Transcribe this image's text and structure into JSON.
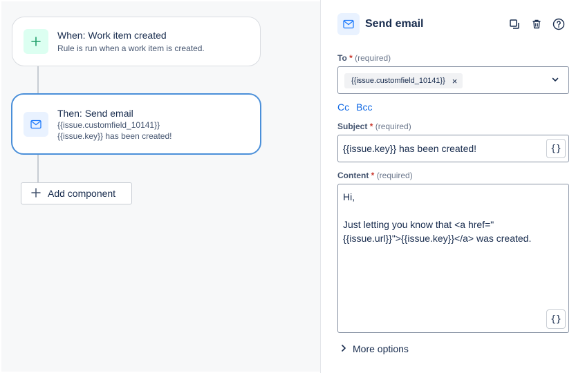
{
  "canvas": {
    "trigger": {
      "title": "When: Work item created",
      "subtitle": "Rule is run when a work item is created.",
      "icon": "plus-icon",
      "accent": "#22a06b"
    },
    "action": {
      "title": "Then: Send email",
      "line1": "{{issue.customfield_10141}}",
      "line2": "{{issue.key}} has been created!",
      "icon": "mail-icon",
      "accent": "#4a8fd9"
    },
    "add_component": {
      "label": "Add component",
      "icon": "plus-icon"
    }
  },
  "panel": {
    "title": "Send email",
    "header_actions": [
      "duplicate-icon",
      "trash-icon",
      "help-icon"
    ],
    "to": {
      "label": "To",
      "star": "*",
      "required_text": "(required)",
      "chip": "{{issue.customfield_10141}}",
      "chip_remove": "×"
    },
    "cc_label": "Cc",
    "bcc_label": "Bcc",
    "subject": {
      "label": "Subject",
      "star": "*",
      "required_text": "(required)",
      "value": "{{issue.key}} has been created!",
      "smart_value_button": "{}"
    },
    "content": {
      "label": "Content",
      "star": "*",
      "required_text": "(required)",
      "value": "Hi,\n\nJust letting you know that <a href=\"\n{{issue.url}}\">{{issue.key}}</a> was created.",
      "smart_value_button": "{}"
    },
    "more_options": "More options"
  }
}
